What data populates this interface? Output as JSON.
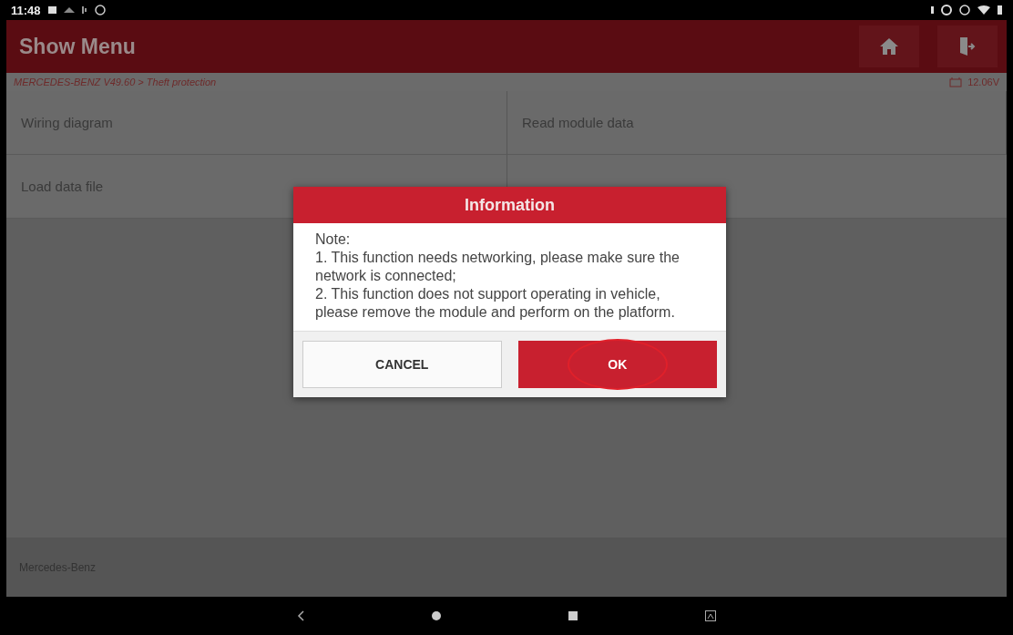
{
  "status_bar": {
    "time": "11:48"
  },
  "header": {
    "title": "Show Menu"
  },
  "breadcrumb": {
    "path": "MERCEDES-BENZ V49.60 > Theft protection",
    "voltage": "12.06V"
  },
  "menu_items": [
    {
      "label": "Wiring diagram"
    },
    {
      "label": "Read module data"
    },
    {
      "label": "Load data file"
    }
  ],
  "footer": {
    "text": "Mercedes-Benz"
  },
  "dialog": {
    "title": "Information",
    "lines": [
      "Note:",
      "1. This function needs networking, please make sure the network is connected;",
      "2. This function does not support operating in vehicle, please remove the module and perform on the platform."
    ],
    "buttons": [
      {
        "label": "CANCEL",
        "kind": "secondary",
        "highlighted": false
      },
      {
        "label": "OK",
        "kind": "primary",
        "highlighted": true
      }
    ]
  }
}
